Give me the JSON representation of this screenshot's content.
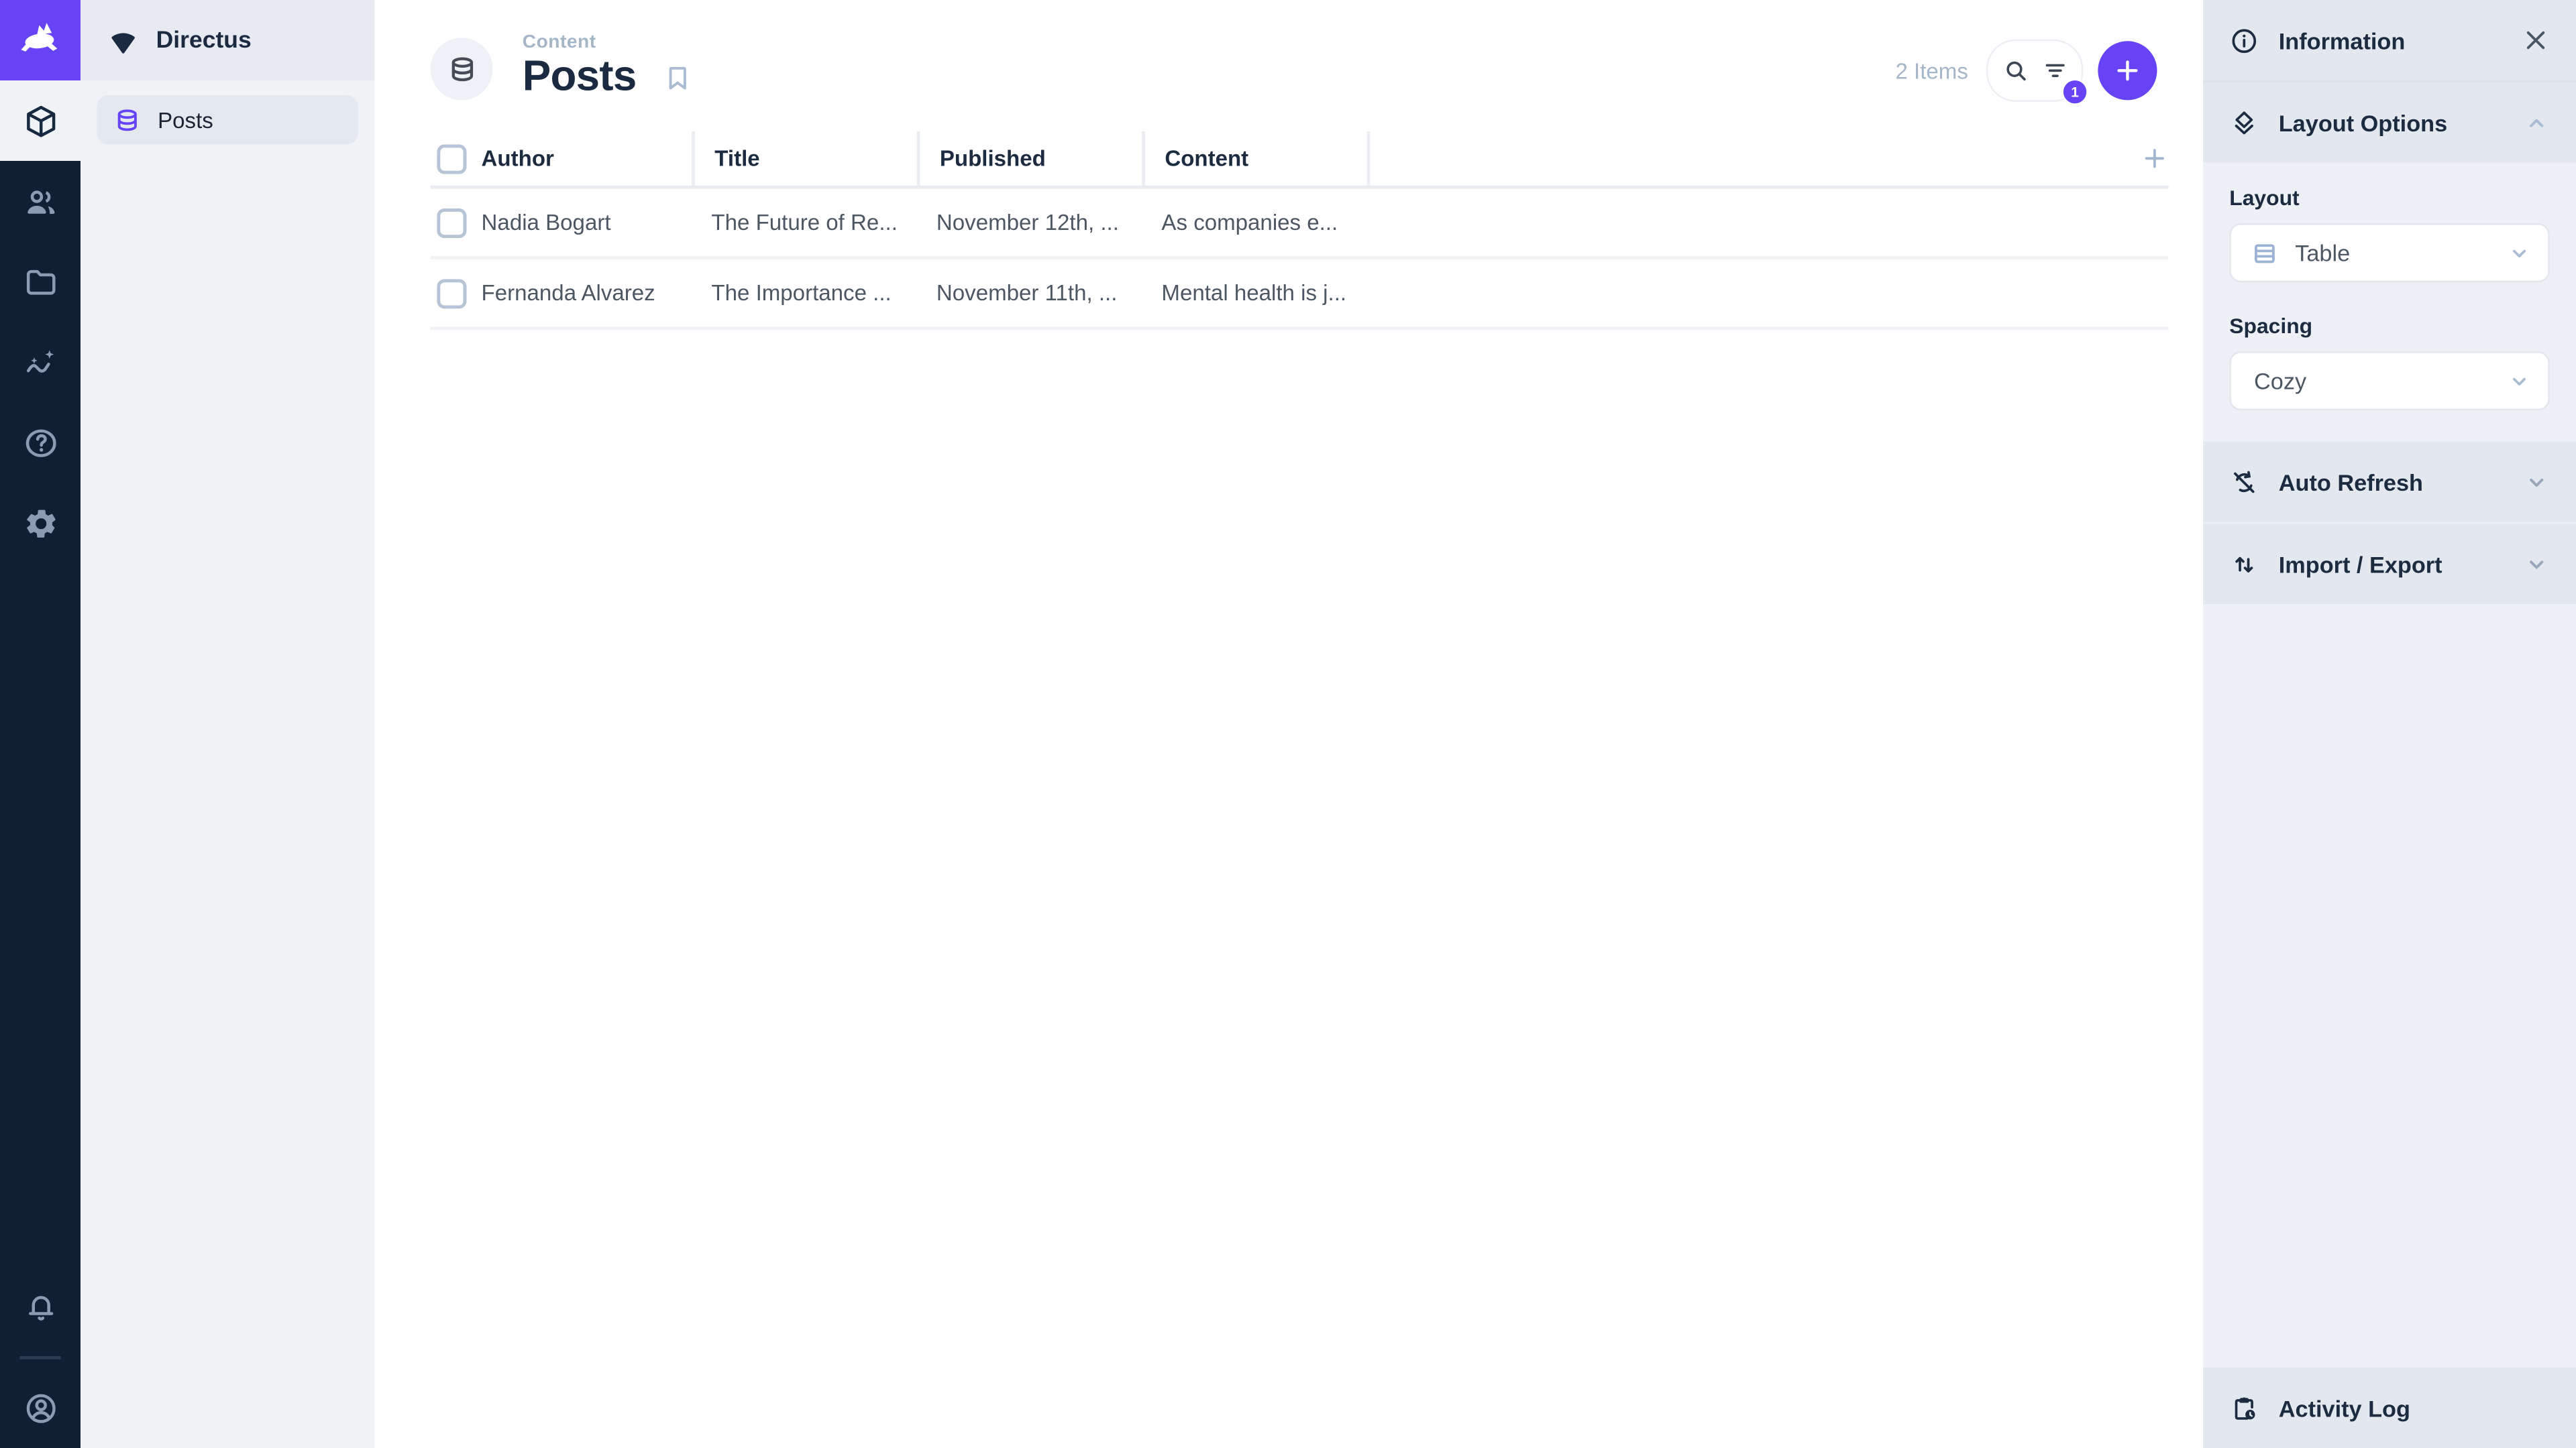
{
  "colors": {
    "accent": "#6644f5",
    "module_bar_bg": "#121e33",
    "module_icon_muted": "#8b9bb1",
    "nav_bg": "#f0f3f6",
    "nav_header_bg": "#e7ebf1",
    "sidebar_section_bg": "#e3e8ee",
    "sidebar_body_bg": "#edf0f4",
    "text_dark": "#1b2a41",
    "text_muted": "#a4b6c8",
    "text_body": "#4d5764"
  },
  "module_bar": {
    "logo_icon": "directus-rabbit-icon",
    "modules": [
      {
        "name": "content",
        "icon": "box-icon",
        "active": true
      },
      {
        "name": "user-directory",
        "icon": "people-icon",
        "active": false
      },
      {
        "name": "file-library",
        "icon": "folder-icon",
        "active": false
      },
      {
        "name": "insights",
        "icon": "insights-icon",
        "active": false
      },
      {
        "name": "help",
        "icon": "help-icon",
        "active": false
      },
      {
        "name": "settings",
        "icon": "gear-icon",
        "active": false
      }
    ],
    "bottom": [
      {
        "name": "notifications",
        "icon": "bell-icon"
      },
      {
        "name": "user-menu",
        "icon": "user-circle-icon"
      }
    ]
  },
  "nav": {
    "project_name": "Directus",
    "project_icon": "wedge-icon",
    "items": [
      {
        "label": "Posts",
        "icon": "database-icon",
        "active": true
      }
    ]
  },
  "header": {
    "breadcrumb": "Content",
    "title": "Posts",
    "collection_icon": "database-icon",
    "bookmark_icon": "bookmark-icon",
    "items_count": "2 Items",
    "search_icon": "search-icon",
    "filter_icon": "filter-icon",
    "filter_badge": "1",
    "add_icon": "plus-icon"
  },
  "table": {
    "columns": [
      "Author",
      "Title",
      "Published",
      "Content"
    ],
    "rows": [
      {
        "author": "Nadia Bogart",
        "title": "The Future of Re...",
        "published": "November 12th, ...",
        "content": "As companies e..."
      },
      {
        "author": "Fernanda Alvarez",
        "title": "The Importance ...",
        "published": "November 11th, ...",
        "content": "Mental health is j..."
      }
    ],
    "add_column_icon": "plus-icon"
  },
  "sidebar": {
    "title": "Information",
    "title_icon": "info-icon",
    "close_icon": "close-icon",
    "sections": [
      {
        "label": "Layout Options",
        "icon": "layers-icon",
        "state": "expanded",
        "chevron": "chevron-up-icon"
      },
      {
        "label": "Auto Refresh",
        "icon": "sync-disabled-icon",
        "state": "collapsed",
        "chevron": "chevron-down-icon"
      },
      {
        "label": "Import / Export",
        "icon": "swap-vert-icon",
        "state": "collapsed",
        "chevron": "chevron-down-icon"
      }
    ],
    "fields": [
      {
        "label": "Layout",
        "value": "Table",
        "icon": "table-icon"
      },
      {
        "label": "Spacing",
        "value": "Cozy"
      }
    ],
    "activity_log": {
      "label": "Activity Log",
      "icon": "clipboard-clock-icon"
    }
  },
  "icons": {
    "directus-rabbit-icon": "leaping rabbit logo (white on purple)",
    "wedge-icon": "rounded fan / wedge project mark",
    "box-icon": "3d cube outline",
    "people-icon": "two people",
    "folder-icon": "folder outline",
    "insights-icon": "wavy line with sparkles",
    "help-icon": "question mark in circle",
    "gear-icon": "settings gear",
    "bell-icon": "notification bell",
    "user-circle-icon": "person in circle",
    "database-icon": "database cylinder",
    "bookmark-icon": "bookmark outline",
    "search-icon": "magnifier",
    "filter-icon": "filter lines",
    "plus-icon": "plus",
    "info-icon": "circled i",
    "close-icon": "x",
    "layers-icon": "stacked diamond layers",
    "chevron-up-icon": "chevron up",
    "chevron-down-icon": "chevron down",
    "table-icon": "table rows square",
    "sync-disabled-icon": "sync arrows with slash",
    "swap-vert-icon": "up and down arrows",
    "clipboard-clock-icon": "clipboard with clock"
  }
}
